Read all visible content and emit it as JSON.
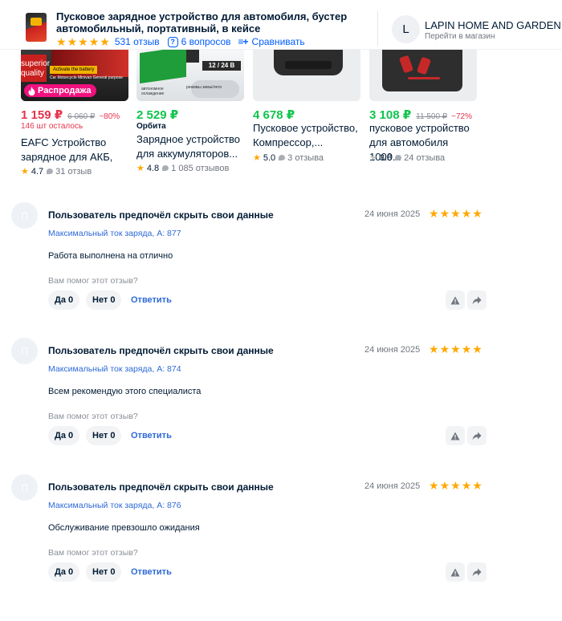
{
  "header": {
    "product_title": "Пусковое зарядное устройство для автомобиля, бустер автомобильный, портативный, в кейсе",
    "rating_stars": 5,
    "reviews_count": "531 отзыв",
    "questions": "6 вопросов",
    "compare": "Сравнивать",
    "store_initial": "L",
    "store_name": "LAPIN HOME AND GARDEN",
    "store_link": "Перейти в магазин"
  },
  "products": [
    {
      "price": "1 159 ₽",
      "old_price": "6 060 ₽",
      "discount": "−80%",
      "sub": "146 шт осталось",
      "sub_color": "#e5334b",
      "price_color": "#e5334b",
      "name": "EAFC Устройство зарядное для АКБ,",
      "rating": "4.7",
      "reviews": "31 отзыв",
      "badge": "Распродажа",
      "img_text_1": "superior",
      "img_text_2": "quality",
      "img_text_3": "Activate the battery",
      "img_text_4": "Car Motorcycle Minivan General purpose"
    },
    {
      "price": "2 529 ₽",
      "old_price": "",
      "discount": "",
      "sub": "Орбита",
      "sub_color": "#001a34",
      "price_color": "#10c44c",
      "name": "Зарядное устройство для аккумуляторов...",
      "rating": "4.8",
      "reviews": "1 085 отзывов",
      "img_text_1": "12 / 24 В",
      "img_text_2": "режимы зимы/лето",
      "img_text_3": "автономное охлаждение"
    },
    {
      "price": "4 678 ₽",
      "old_price": "",
      "discount": "",
      "sub": "",
      "price_color": "#10c44c",
      "name": "Пусковое устройство, Компрессор,...",
      "rating": "5.0",
      "reviews": "3 отзыва"
    },
    {
      "price": "3 108 ₽",
      "old_price": "11 500 ₽",
      "discount": "−72%",
      "sub": "",
      "price_color": "#10c44c",
      "name": "пусковое устройство для автомобиля 1000...",
      "rating": "3.8",
      "reviews": "24 отзыва"
    }
  ],
  "reviews": [
    {
      "avatar_initial": "П",
      "author": "Пользователь предпочёл скрыть свои данные",
      "date": "24 июня 2025",
      "stars": 5,
      "attribute": "Максимальный ток заряда, А: 877",
      "text": "Работа выполнена на отлично",
      "helpful_question": "Вам помог этот отзыв?",
      "yes_label": "Да 0",
      "no_label": "Нет 0",
      "reply_label": "Ответить"
    },
    {
      "avatar_initial": "П",
      "author": "Пользователь предпочёл скрыть свои данные",
      "date": "24 июня 2025",
      "stars": 5,
      "attribute": "Максимальный ток заряда, А: 874",
      "text": "Всем рекомендую этого специалиста",
      "helpful_question": "Вам помог этот отзыв?",
      "yes_label": "Да 0",
      "no_label": "Нет 0",
      "reply_label": "Ответить"
    },
    {
      "avatar_initial": "П",
      "author": "Пользователь предпочёл скрыть свои данные",
      "date": "24 июня 2025",
      "stars": 5,
      "attribute": "Максимальный ток заряда, А: 876",
      "text": "Обслуживание превзошло ожидания",
      "helpful_question": "Вам помог этот отзыв?",
      "yes_label": "Да 0",
      "no_label": "Нет 0",
      "reply_label": "Ответить"
    }
  ],
  "colors": {
    "accent_blue": "#005bff",
    "star": "#ffa800",
    "sale_pink": "#f1117e",
    "price_green": "#10c44c",
    "price_red": "#e5334b"
  },
  "icons": [
    "star-icon",
    "question-icon",
    "compare-icon",
    "fire-icon",
    "comment-icon",
    "report-icon",
    "share-icon"
  ]
}
